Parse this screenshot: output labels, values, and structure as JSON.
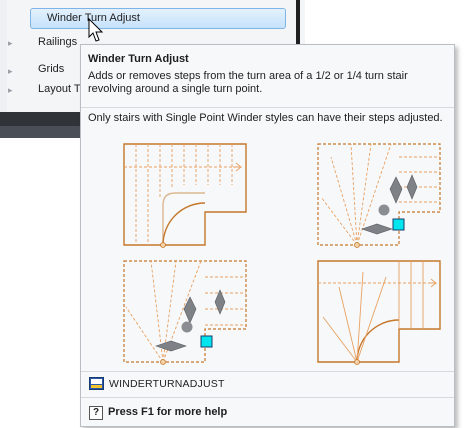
{
  "menu": {
    "highlighted_item": "Winder Turn Adjust",
    "items": [
      "Railings",
      "Grids",
      "Layout T"
    ]
  },
  "tooltip": {
    "title": "Winder Turn Adjust",
    "description": "Adds or removes steps from the turn area of a 1/2 or 1/4 turn stair revolving around a single turn point.",
    "note": "Only stairs with Single Point Winder styles can have their steps adjusted.",
    "command": "WINDERTURNADJUST",
    "help": "Press F1 for more help",
    "help_key": "?"
  },
  "colors": {
    "stair_line": "#c5772a",
    "stair_dashed": "#e8a060",
    "grip_fill": "#00e5ee",
    "grip_gray": "#7e8287"
  }
}
